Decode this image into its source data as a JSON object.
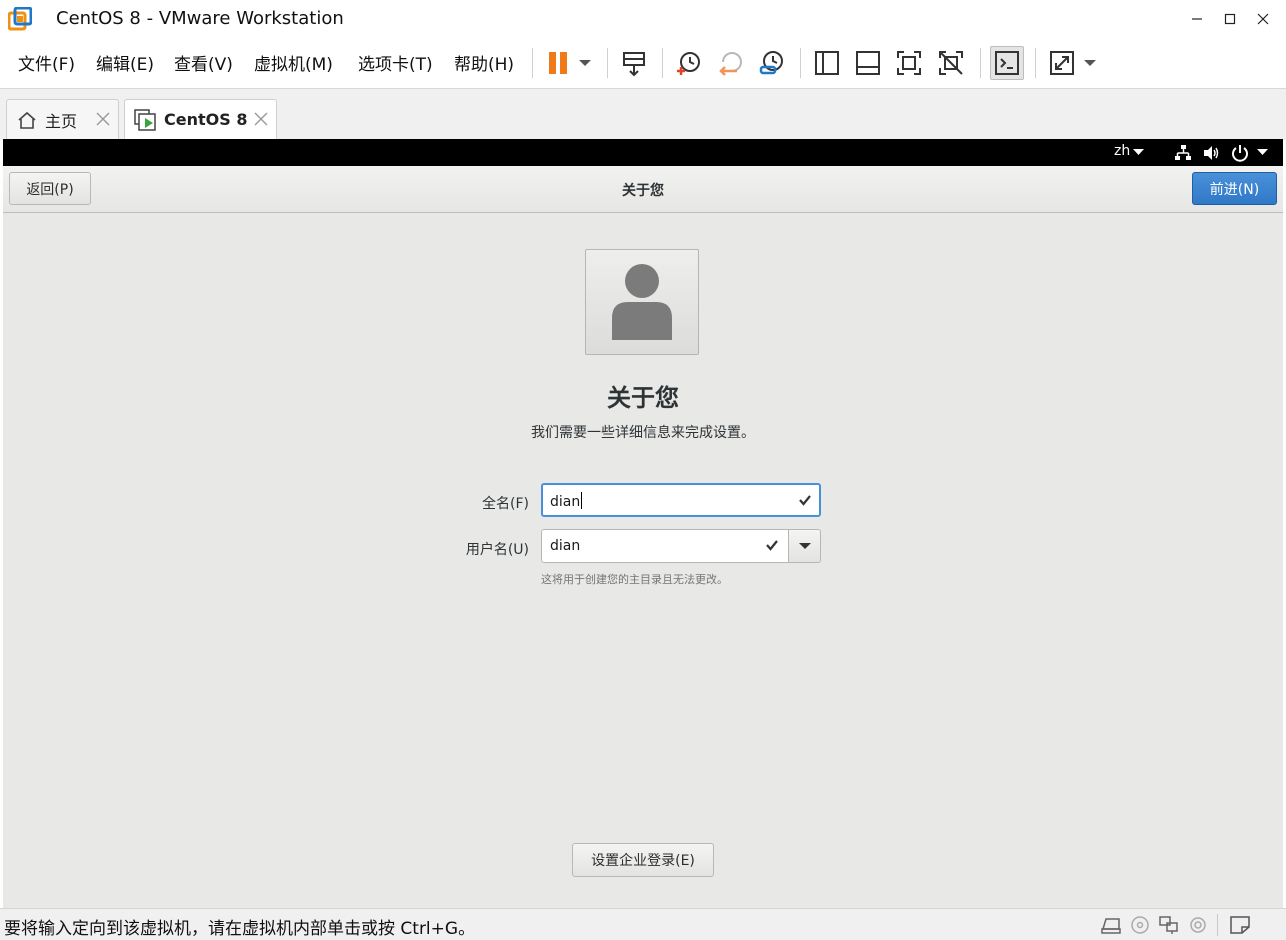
{
  "window": {
    "title": "CentOS 8 - VMware Workstation"
  },
  "menu": {
    "items": [
      "文件(F)",
      "编辑(E)",
      "查看(V)",
      "虚拟机(M)",
      "选项卡(T)",
      "帮助(H)"
    ]
  },
  "toolbar": {
    "icons": [
      "pause-icon",
      "dropdown-arrow-icon",
      "send-ctrl-alt-del-icon",
      "snapshot-take-icon",
      "snapshot-revert-icon",
      "snapshot-manager-icon",
      "library-view-icon",
      "thumbnail-bar-icon",
      "fullscreen-icon",
      "unity-icon",
      "console-view-icon",
      "stretch-guest-icon",
      "dropdown-arrow-icon"
    ]
  },
  "tabs": [
    {
      "label": "主页",
      "active": false
    },
    {
      "label": "CentOS 8",
      "active": true
    }
  ],
  "guest": {
    "top_bar": {
      "language": "zh"
    },
    "header": {
      "back_label": "返回(P)",
      "title": "关于您",
      "next_label": "前进(N)"
    },
    "page": {
      "heading": "关于您",
      "subtitle": "我们需要一些详细信息来完成设置。",
      "fullname_label": "全名(F)",
      "fullname_value": "dian",
      "username_label": "用户名(U)",
      "username_value": "dian",
      "hint": "这将用于创建您的主目录且无法更改。",
      "enterprise_label": "设置企业登录(E)"
    },
    "colors": {
      "accent": "#4a90d9",
      "background": "#e8e8e7"
    }
  },
  "status": {
    "text": "要将输入定向到该虚拟机，请在虚拟机内部单击或按 Ctrl+G。"
  }
}
